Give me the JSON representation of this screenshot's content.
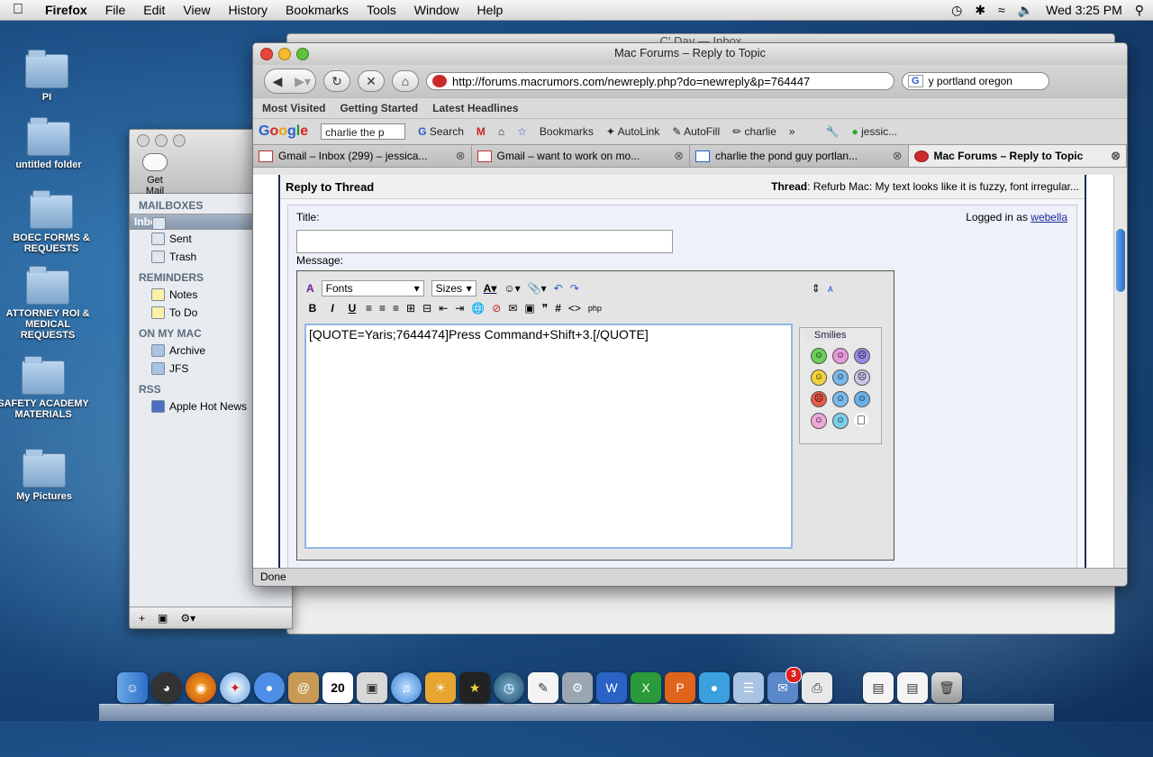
{
  "menubar": {
    "app": "Firefox",
    "items": [
      "File",
      "Edit",
      "View",
      "History",
      "Bookmarks",
      "Tools",
      "Window",
      "Help"
    ],
    "clock": "Wed 3:25 PM"
  },
  "desktop": {
    "icons": [
      {
        "label": "PI"
      },
      {
        "label": "untitled folder"
      },
      {
        "label": "BOEC FORMS & REQUESTS"
      },
      {
        "label": "ATTORNEY ROI & MEDICAL REQUESTS"
      },
      {
        "label": "SAFETY ACADEMY MATERIALS"
      },
      {
        "label": "My Pictures"
      }
    ]
  },
  "behind_window": {
    "title": "C' Day — Inbox"
  },
  "mail": {
    "get_mail": "Get Mail",
    "sections": [
      {
        "title": "MAILBOXES",
        "items": [
          "Inbox",
          "Sent",
          "Trash"
        ]
      },
      {
        "title": "REMINDERS",
        "items": [
          "Notes",
          "To Do"
        ]
      },
      {
        "title": "ON MY MAC",
        "items": [
          "Archive",
          "JFS"
        ]
      },
      {
        "title": "RSS",
        "items": [
          "Apple Hot News"
        ]
      }
    ]
  },
  "firefox": {
    "title": "Mac Forums – Reply to Topic",
    "url": "http://forums.macrumors.com/newreply.php?do=newreply&p=764447",
    "search_value": "y portland oregon",
    "bookmarks": [
      "Most Visited",
      "Getting Started",
      "Latest Headlines"
    ],
    "google_toolbar": {
      "input": "charlie the p",
      "search": "Search",
      "bookmarks": "Bookmarks",
      "autolink": "AutoLink",
      "autofill": "AutoFill",
      "charlie": "charlie",
      "user": "jessic..."
    },
    "tabs": [
      "Gmail – Inbox (299) – jessica...",
      "Gmail – want to work on mo...",
      "charlie the pond guy portlan...",
      "Mac Forums – Reply to Topic"
    ],
    "status": "Done"
  },
  "forum": {
    "heading": "Reply to Thread",
    "thread_label": "Thread",
    "thread_title": ": Refurb Mac: My text looks like it is fuzzy, font irregular...",
    "title_label": "Title:",
    "message_label": "Message:",
    "logged_in_prefix": "Logged in as ",
    "username": "webella",
    "fonts": "Fonts",
    "sizes": "Sizes",
    "message_text": "[QUOTE=Yaris;7644474]Press Command+Shift+3.[/QUOTE]",
    "smilies_title": "Smilies"
  },
  "dock": {
    "mail_badge": "3"
  }
}
